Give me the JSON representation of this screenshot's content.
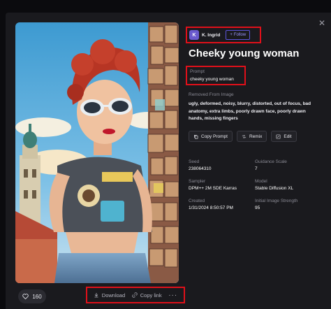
{
  "user": {
    "initial": "K",
    "name": "K. Ingrid",
    "follow_label": "Follow"
  },
  "title": "Cheeky young woman",
  "prompt": {
    "label": "Prompt",
    "text": "cheeky young woman"
  },
  "removed": {
    "label": "Removed From Image",
    "text": "ugly, deformed, noisy, blurry, distorted, out of focus, bad anatomy, extra limbs, poorly drawn face, poorly drawn hands, missing fingers"
  },
  "buttons": {
    "copy_prompt": "Copy Prompt",
    "remix": "Remix",
    "edit": "Edit"
  },
  "meta": {
    "seed_label": "Seed",
    "seed": "238064310",
    "guidance_label": "Guidance Scale",
    "guidance": "7",
    "sampler_label": "Sampler",
    "sampler": "DPM++ 2M SDE Karras",
    "model_label": "Model",
    "model": "Stable Diffusion XL",
    "created_label": "Created",
    "created": "1/31/2024 8:50:57 PM",
    "strength_label": "Initial Image Strength",
    "strength": "95"
  },
  "footer": {
    "likes": "160",
    "download": "Download",
    "copy_link": "Copy link",
    "more": "···"
  },
  "colors": {
    "highlight": "#e0101a",
    "accent": "#5c55d8",
    "panel_bg": "#1a1a1e"
  },
  "icons": [
    "close-icon",
    "heart-icon",
    "download-icon",
    "link-icon",
    "copy-icon",
    "remix-icon",
    "edit-icon",
    "plus-icon"
  ]
}
